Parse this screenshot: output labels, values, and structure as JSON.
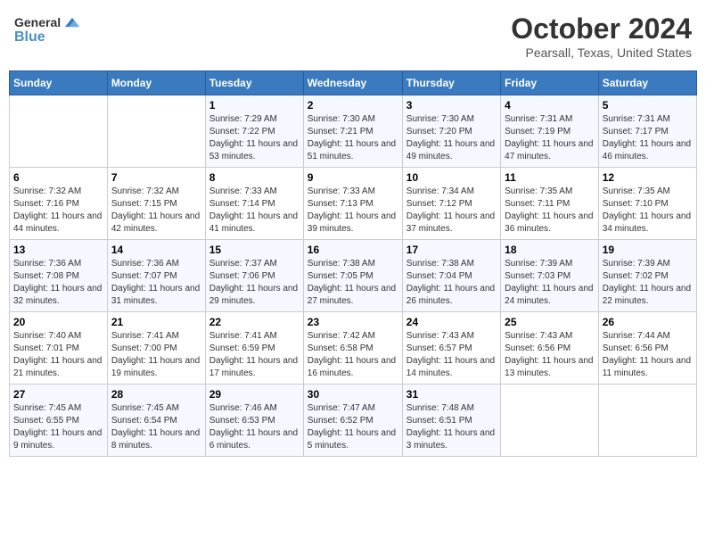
{
  "logo": {
    "text1": "General",
    "text2": "Blue"
  },
  "header": {
    "month": "October 2024",
    "location": "Pearsall, Texas, United States"
  },
  "days_of_week": [
    "Sunday",
    "Monday",
    "Tuesday",
    "Wednesday",
    "Thursday",
    "Friday",
    "Saturday"
  ],
  "weeks": [
    [
      {
        "day": "",
        "sunrise": "",
        "sunset": "",
        "daylight": ""
      },
      {
        "day": "",
        "sunrise": "",
        "sunset": "",
        "daylight": ""
      },
      {
        "day": "1",
        "sunrise": "Sunrise: 7:29 AM",
        "sunset": "Sunset: 7:22 PM",
        "daylight": "Daylight: 11 hours and 53 minutes."
      },
      {
        "day": "2",
        "sunrise": "Sunrise: 7:30 AM",
        "sunset": "Sunset: 7:21 PM",
        "daylight": "Daylight: 11 hours and 51 minutes."
      },
      {
        "day": "3",
        "sunrise": "Sunrise: 7:30 AM",
        "sunset": "Sunset: 7:20 PM",
        "daylight": "Daylight: 11 hours and 49 minutes."
      },
      {
        "day": "4",
        "sunrise": "Sunrise: 7:31 AM",
        "sunset": "Sunset: 7:19 PM",
        "daylight": "Daylight: 11 hours and 47 minutes."
      },
      {
        "day": "5",
        "sunrise": "Sunrise: 7:31 AM",
        "sunset": "Sunset: 7:17 PM",
        "daylight": "Daylight: 11 hours and 46 minutes."
      }
    ],
    [
      {
        "day": "6",
        "sunrise": "Sunrise: 7:32 AM",
        "sunset": "Sunset: 7:16 PM",
        "daylight": "Daylight: 11 hours and 44 minutes."
      },
      {
        "day": "7",
        "sunrise": "Sunrise: 7:32 AM",
        "sunset": "Sunset: 7:15 PM",
        "daylight": "Daylight: 11 hours and 42 minutes."
      },
      {
        "day": "8",
        "sunrise": "Sunrise: 7:33 AM",
        "sunset": "Sunset: 7:14 PM",
        "daylight": "Daylight: 11 hours and 41 minutes."
      },
      {
        "day": "9",
        "sunrise": "Sunrise: 7:33 AM",
        "sunset": "Sunset: 7:13 PM",
        "daylight": "Daylight: 11 hours and 39 minutes."
      },
      {
        "day": "10",
        "sunrise": "Sunrise: 7:34 AM",
        "sunset": "Sunset: 7:12 PM",
        "daylight": "Daylight: 11 hours and 37 minutes."
      },
      {
        "day": "11",
        "sunrise": "Sunrise: 7:35 AM",
        "sunset": "Sunset: 7:11 PM",
        "daylight": "Daylight: 11 hours and 36 minutes."
      },
      {
        "day": "12",
        "sunrise": "Sunrise: 7:35 AM",
        "sunset": "Sunset: 7:10 PM",
        "daylight": "Daylight: 11 hours and 34 minutes."
      }
    ],
    [
      {
        "day": "13",
        "sunrise": "Sunrise: 7:36 AM",
        "sunset": "Sunset: 7:08 PM",
        "daylight": "Daylight: 11 hours and 32 minutes."
      },
      {
        "day": "14",
        "sunrise": "Sunrise: 7:36 AM",
        "sunset": "Sunset: 7:07 PM",
        "daylight": "Daylight: 11 hours and 31 minutes."
      },
      {
        "day": "15",
        "sunrise": "Sunrise: 7:37 AM",
        "sunset": "Sunset: 7:06 PM",
        "daylight": "Daylight: 11 hours and 29 minutes."
      },
      {
        "day": "16",
        "sunrise": "Sunrise: 7:38 AM",
        "sunset": "Sunset: 7:05 PM",
        "daylight": "Daylight: 11 hours and 27 minutes."
      },
      {
        "day": "17",
        "sunrise": "Sunrise: 7:38 AM",
        "sunset": "Sunset: 7:04 PM",
        "daylight": "Daylight: 11 hours and 26 minutes."
      },
      {
        "day": "18",
        "sunrise": "Sunrise: 7:39 AM",
        "sunset": "Sunset: 7:03 PM",
        "daylight": "Daylight: 11 hours and 24 minutes."
      },
      {
        "day": "19",
        "sunrise": "Sunrise: 7:39 AM",
        "sunset": "Sunset: 7:02 PM",
        "daylight": "Daylight: 11 hours and 22 minutes."
      }
    ],
    [
      {
        "day": "20",
        "sunrise": "Sunrise: 7:40 AM",
        "sunset": "Sunset: 7:01 PM",
        "daylight": "Daylight: 11 hours and 21 minutes."
      },
      {
        "day": "21",
        "sunrise": "Sunrise: 7:41 AM",
        "sunset": "Sunset: 7:00 PM",
        "daylight": "Daylight: 11 hours and 19 minutes."
      },
      {
        "day": "22",
        "sunrise": "Sunrise: 7:41 AM",
        "sunset": "Sunset: 6:59 PM",
        "daylight": "Daylight: 11 hours and 17 minutes."
      },
      {
        "day": "23",
        "sunrise": "Sunrise: 7:42 AM",
        "sunset": "Sunset: 6:58 PM",
        "daylight": "Daylight: 11 hours and 16 minutes."
      },
      {
        "day": "24",
        "sunrise": "Sunrise: 7:43 AM",
        "sunset": "Sunset: 6:57 PM",
        "daylight": "Daylight: 11 hours and 14 minutes."
      },
      {
        "day": "25",
        "sunrise": "Sunrise: 7:43 AM",
        "sunset": "Sunset: 6:56 PM",
        "daylight": "Daylight: 11 hours and 13 minutes."
      },
      {
        "day": "26",
        "sunrise": "Sunrise: 7:44 AM",
        "sunset": "Sunset: 6:56 PM",
        "daylight": "Daylight: 11 hours and 11 minutes."
      }
    ],
    [
      {
        "day": "27",
        "sunrise": "Sunrise: 7:45 AM",
        "sunset": "Sunset: 6:55 PM",
        "daylight": "Daylight: 11 hours and 9 minutes."
      },
      {
        "day": "28",
        "sunrise": "Sunrise: 7:45 AM",
        "sunset": "Sunset: 6:54 PM",
        "daylight": "Daylight: 11 hours and 8 minutes."
      },
      {
        "day": "29",
        "sunrise": "Sunrise: 7:46 AM",
        "sunset": "Sunset: 6:53 PM",
        "daylight": "Daylight: 11 hours and 6 minutes."
      },
      {
        "day": "30",
        "sunrise": "Sunrise: 7:47 AM",
        "sunset": "Sunset: 6:52 PM",
        "daylight": "Daylight: 11 hours and 5 minutes."
      },
      {
        "day": "31",
        "sunrise": "Sunrise: 7:48 AM",
        "sunset": "Sunset: 6:51 PM",
        "daylight": "Daylight: 11 hours and 3 minutes."
      },
      {
        "day": "",
        "sunrise": "",
        "sunset": "",
        "daylight": ""
      },
      {
        "day": "",
        "sunrise": "",
        "sunset": "",
        "daylight": ""
      }
    ]
  ]
}
